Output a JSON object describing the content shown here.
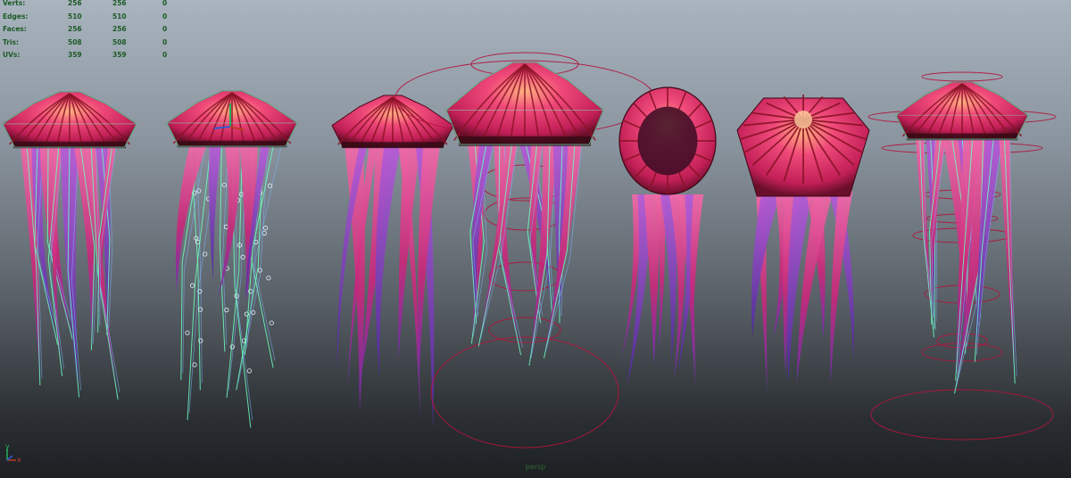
{
  "heads_up_display": {
    "poly_count": [
      {
        "label": "Verts:",
        "values": [
          "256",
          "256",
          "0"
        ]
      },
      {
        "label": "Edges:",
        "values": [
          "510",
          "510",
          "0"
        ]
      },
      {
        "label": "Faces:",
        "values": [
          "256",
          "256",
          "0"
        ]
      },
      {
        "label": "Tris:",
        "values": [
          "508",
          "508",
          "0"
        ]
      },
      {
        "label": "UVs:",
        "values": [
          "359",
          "359",
          "0"
        ]
      }
    ]
  },
  "camera": {
    "name": "persp"
  },
  "axis_gizmo": {
    "x": "x",
    "y": "y",
    "colors": {
      "x": "#c0392b",
      "y": "#27ae60",
      "z": "#2c5dcf"
    }
  },
  "colors": {
    "wireframe": "#6dffc0",
    "joint_circle": "#b0143c",
    "bell_base": "#d9306a",
    "bell_stripe": "#8a1326",
    "tentacle_pink": "#d8327a",
    "tentacle_purple": "#7a3fbf"
  },
  "scene": {
    "objects": [
      {
        "name": "jellyfish-front-textured-wire"
      },
      {
        "name": "jellyfish-skeleton-rig"
      },
      {
        "name": "jellyfish-textured"
      },
      {
        "name": "jellyfish-with-control-circles"
      },
      {
        "name": "jellyfish-bottom-view"
      },
      {
        "name": "jellyfish-top-view"
      },
      {
        "name": "jellyfish-with-controls-side"
      }
    ]
  }
}
